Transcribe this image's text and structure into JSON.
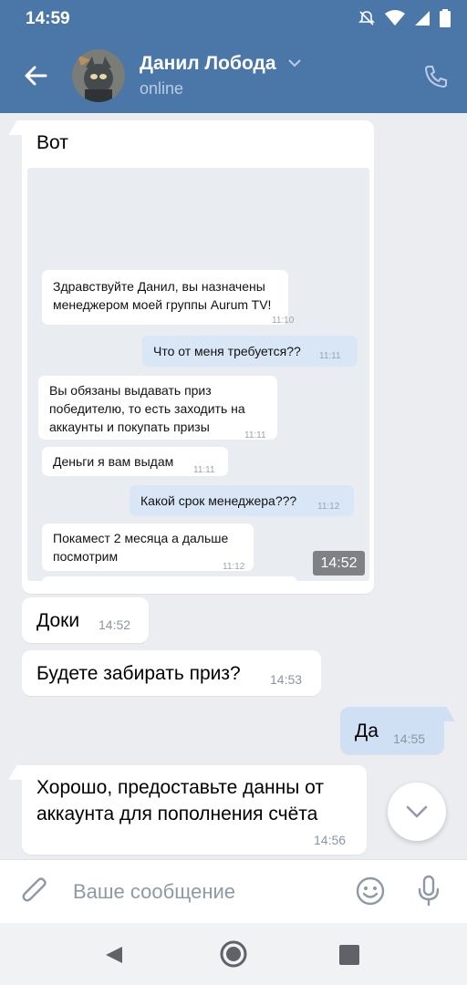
{
  "status_bar": {
    "time": "14:59"
  },
  "header": {
    "contact_name": "Данил Лобода",
    "contact_status": "online"
  },
  "messages": [
    {
      "text": "Вот",
      "time": "14:52",
      "direction": "in"
    },
    {
      "text": "Доки",
      "time": "14:52",
      "direction": "in"
    },
    {
      "text": "Будете забирать приз?",
      "time": "14:53",
      "direction": "in"
    },
    {
      "text": "Да",
      "time": "14:55",
      "direction": "out"
    },
    {
      "text": "Хорошо, предоставьте данны от аккаунта для пополнения счёта",
      "time": "14:56",
      "direction": "in"
    }
  ],
  "screenshot_messages": [
    {
      "text": "Здравствуйте Данил, вы назначены менеджером моей группы Aurum TV!",
      "time": "11:10",
      "direction": "in"
    },
    {
      "text": "Что от меня требуется??",
      "time": "11:11",
      "direction": "out"
    },
    {
      "text": "Вы обязаны выдавать приз победителю, то есть заходить на аккаунты и покупать призы",
      "time": "11:11",
      "direction": "in"
    },
    {
      "text": "Деньги я вам выдам",
      "time": "11:11",
      "direction": "in"
    },
    {
      "text": "Какой срок менеджера???",
      "time": "11:12",
      "direction": "out"
    },
    {
      "text": "Покамест 2 месяца а дальше посмотрим",
      "time": "11:12",
      "direction": "in"
    }
  ],
  "composer": {
    "placeholder": "Ваше сообщение"
  },
  "colors": {
    "header": "#4a76a8",
    "outgoing_bubble": "#cfe0f4",
    "incoming_bubble": "#ffffff",
    "background": "#ebedf0"
  },
  "icons": [
    "back-arrow-icon",
    "chevron-down-icon",
    "phone-icon",
    "paperclip-icon",
    "emoji-icon",
    "microphone-icon",
    "nav-back-icon",
    "nav-home-icon",
    "nav-recents-icon"
  ]
}
